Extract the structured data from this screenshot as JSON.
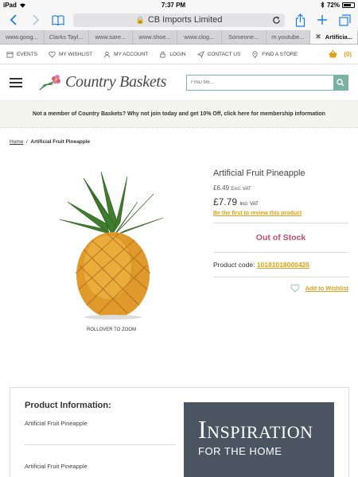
{
  "status_bar": {
    "device": "iPad",
    "time": "7:37 PM",
    "battery": "72%",
    "battery_level": 0.72
  },
  "browser": {
    "url_title": "CB Imports Limited",
    "tabs": [
      {
        "label": "www.goog..."
      },
      {
        "label": "Clarks Tayl..."
      },
      {
        "label": "www.sare..."
      },
      {
        "label": "www.shoe..."
      },
      {
        "label": "www.clog..."
      },
      {
        "label": "Someone..."
      },
      {
        "label": "m.youtube..."
      },
      {
        "label": "Artificia..."
      }
    ]
  },
  "top_links": {
    "events": "EVENTS",
    "wishlist": "MY WISHLIST",
    "account": "MY ACCOUNT",
    "login": "LOGIN",
    "contact": "CONTACT US",
    "store": "FIND A STORE",
    "cart_count": "(0)"
  },
  "header": {
    "logo_text": "Country Baskets",
    "search_placeholder": "FIND ME..."
  },
  "promo": {
    "text": "Not a member of Country Baskets? Why not join today and get 10% Off, click here for membership information"
  },
  "breadcrumb": {
    "home": "Home",
    "separator": "/",
    "current": "Artificial Fruit Pineapple"
  },
  "product": {
    "title": "Artificial Fruit Pineapple",
    "price_ex": "£6.49",
    "price_ex_label": "Excl. VAT",
    "price_inc": "£7.79",
    "price_inc_label": "Incl. VAT",
    "review_link": "Be the first to review this product",
    "stock_status": "Out of Stock",
    "code_label": "Product code:",
    "code": "10181018000426",
    "wishlist_label": "Add to Wishlist",
    "zoom_note": "ROLLOVER TO ZOOM"
  },
  "info_panel": {
    "heading": "Product Information:",
    "line1": "Artificial Fruit Pineapple",
    "line2": "Artificial Fruit Pineapple",
    "banner_big": "Inspiration",
    "banner_small": "FOR THE HOME"
  }
}
